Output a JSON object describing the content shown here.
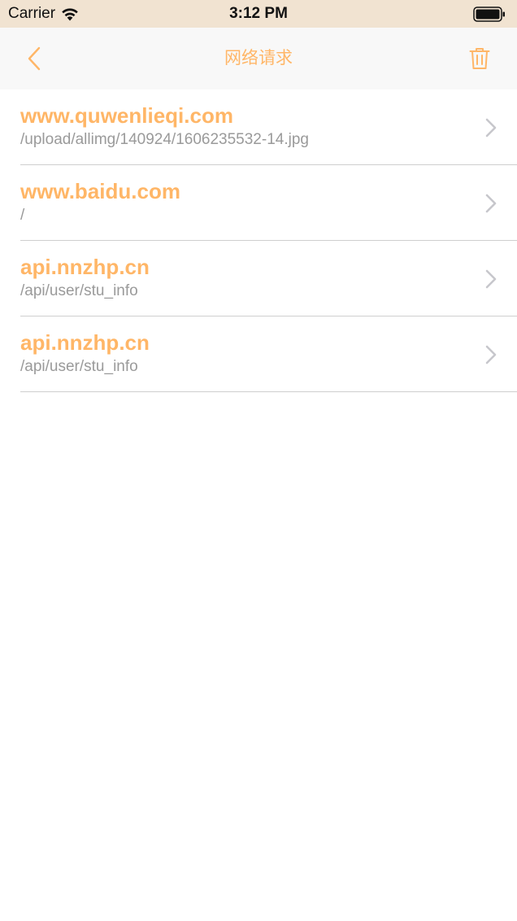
{
  "status_bar": {
    "carrier": "Carrier",
    "time": "3:12 PM",
    "wifi_icon": "wifi-icon",
    "battery_icon": "battery-icon"
  },
  "nav": {
    "back_icon": "chevron-left-icon",
    "title": "网络请求",
    "trash_icon": "trash-icon"
  },
  "colors": {
    "accent": "#ffb667",
    "secondary_text": "#9a9a9a",
    "status_bar_bg": "#f1e3d1",
    "nav_bg": "#f8f8f8",
    "separator": "#cfcfcf",
    "chevron": "#c7c7cc"
  },
  "requests": [
    {
      "host": "www.quwenlieqi.com",
      "path": "/upload/allimg/140924/1606235532-14.jpg"
    },
    {
      "host": "www.baidu.com",
      "path": "/"
    },
    {
      "host": "api.nnzhp.cn",
      "path": "/api/user/stu_info"
    },
    {
      "host": "api.nnzhp.cn",
      "path": "/api/user/stu_info"
    }
  ]
}
